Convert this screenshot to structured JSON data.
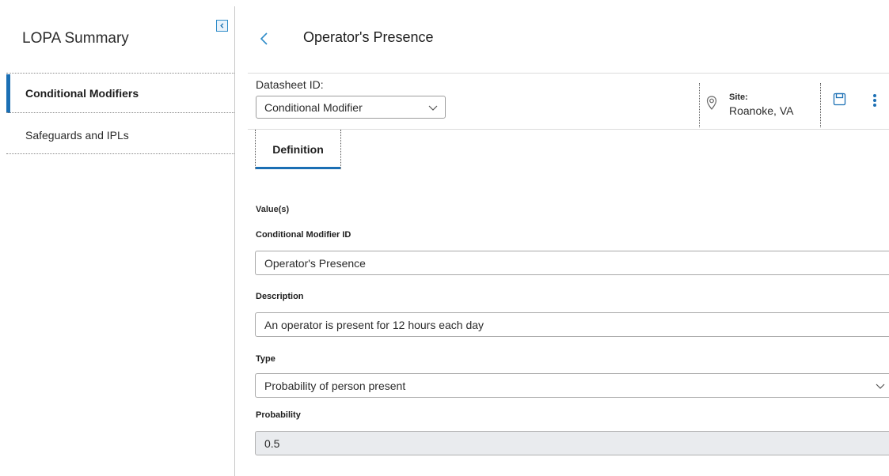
{
  "sidebar": {
    "title": "LOPA Summary",
    "items": [
      {
        "label": "Conditional Modifiers",
        "active": true
      },
      {
        "label": "Safeguards and IPLs",
        "active": false
      }
    ]
  },
  "header": {
    "title": "Operator's Presence",
    "datasheet_label": "Datasheet ID:",
    "datasheet_value": "Conditional Modifier",
    "site_label": "Site:",
    "site_value": "Roanoke, VA"
  },
  "tabs": [
    {
      "label": "Definition",
      "active": true
    }
  ],
  "form": {
    "section_label": "Value(s)",
    "fields": [
      {
        "label": "Conditional Modifier ID",
        "value": "Operator's Presence",
        "type": "text"
      },
      {
        "label": "Description",
        "value": "An operator is present for 12 hours each day",
        "type": "text"
      },
      {
        "label": "Type",
        "value": "Probability of person present",
        "type": "select"
      },
      {
        "label": "Probability",
        "value": "0.5",
        "type": "disabled"
      }
    ]
  },
  "colors": {
    "accent": "#1b6fb4",
    "disabled_bg": "#e9ebee"
  },
  "icons": {
    "collapse": "collapse-panel-icon",
    "back": "chevron-left-icon",
    "site": "location-pin-icon",
    "save": "save-icon",
    "more": "more-vertical-icon",
    "dropdown": "chevron-down-icon"
  }
}
